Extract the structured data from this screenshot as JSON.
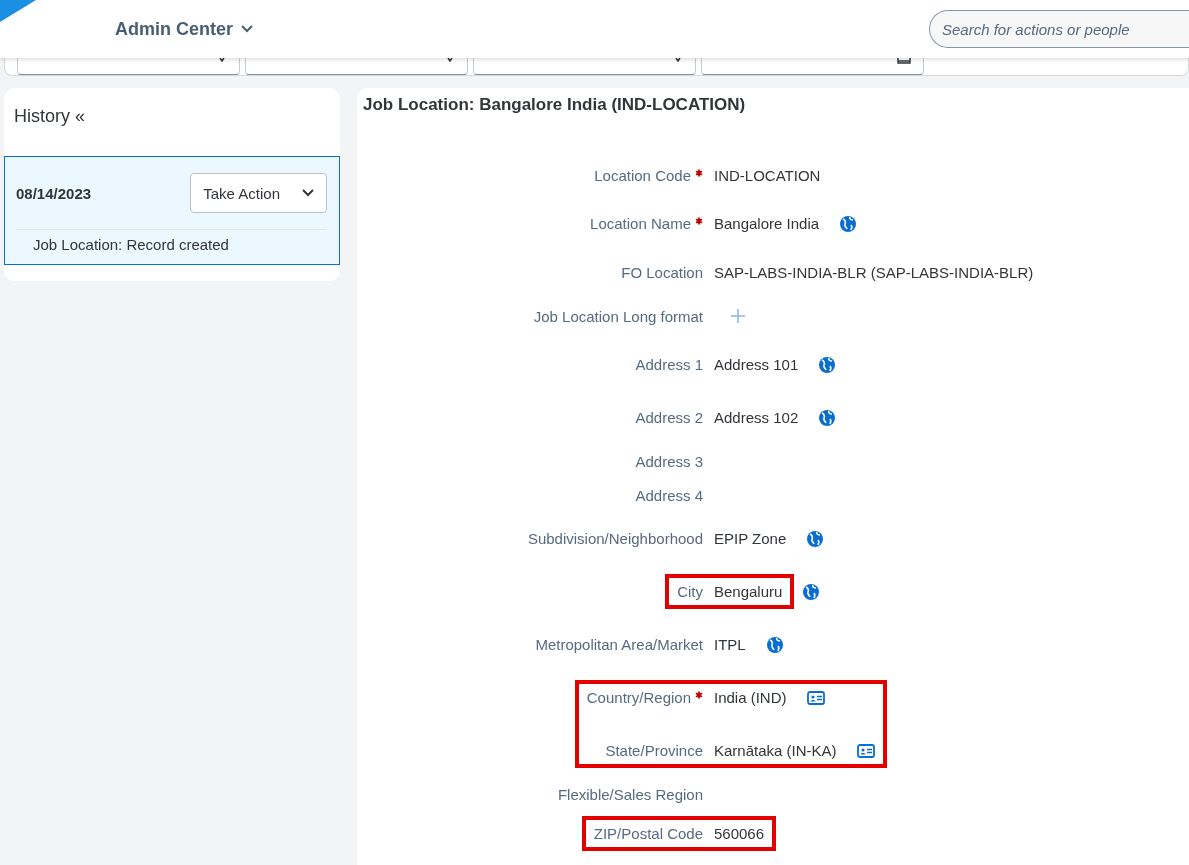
{
  "header": {
    "title": "Admin Center",
    "search": {
      "placeholder": "Search for actions or people"
    }
  },
  "filter_bar": {
    "fields": [
      {
        "kind": "select"
      },
      {
        "kind": "select"
      },
      {
        "kind": "select"
      },
      {
        "kind": "date"
      }
    ]
  },
  "history": {
    "title": "History «",
    "entries": [
      {
        "date": "08/14/2023",
        "selected": true,
        "action": "Take Action",
        "note": "Job Location: Record created"
      }
    ]
  },
  "record": {
    "title": "Job Location: Bangalore India (IND-LOCATION)",
    "groups": [
      {
        "highlighted": false,
        "fields": [
          {
            "label": "Location Code",
            "required": true,
            "value": "IND-LOCATION",
            "kind": "plain"
          },
          {
            "label": "Location Name",
            "required": true,
            "value": "Bangalore India",
            "kind": "translatable"
          },
          {
            "label": "FO Location",
            "required": false,
            "value": "SAP-LABS-INDIA-BLR (SAP-LABS-INDIA-BLR)",
            "kind": "plain"
          },
          {
            "label": "Job Location Long format",
            "required": false,
            "kind": "addable"
          },
          {
            "label": "Address 1",
            "required": false,
            "value": "Address 101",
            "kind": "translatable"
          },
          {
            "label": "Address 2",
            "required": false,
            "value": "Address 102",
            "kind": "translatable"
          },
          {
            "label": "Address 3",
            "required": false,
            "kind": "plain"
          },
          {
            "label": "Address 4",
            "required": false,
            "kind": "plain"
          },
          {
            "label": "Subdivision/Neighborhood",
            "required": false,
            "value": "EPIP Zone",
            "kind": "translatable"
          }
        ]
      },
      {
        "highlighted": true,
        "fields": [
          {
            "label": "City",
            "required": false,
            "value": "Bengaluru",
            "kind": "translatable"
          }
        ]
      },
      {
        "highlighted": false,
        "fields": [
          {
            "label": "Metropolitan Area/Market",
            "required": false,
            "value": "ITPL",
            "kind": "translatable"
          }
        ]
      },
      {
        "highlighted": true,
        "fields": [
          {
            "label": "Country/Region",
            "required": true,
            "value": "India (IND)",
            "kind": "lookup"
          },
          {
            "label": "State/Province",
            "required": false,
            "value": "Karnātaka (IN-KA)",
            "kind": "lookup"
          }
        ]
      },
      {
        "highlighted": false,
        "fields": [
          {
            "label": "Flexible/Sales Region",
            "required": false,
            "kind": "plain"
          }
        ]
      },
      {
        "highlighted": true,
        "fields": [
          {
            "label": "ZIP/Postal Code",
            "required": false,
            "value": "560066",
            "kind": "plain"
          }
        ]
      }
    ]
  }
}
